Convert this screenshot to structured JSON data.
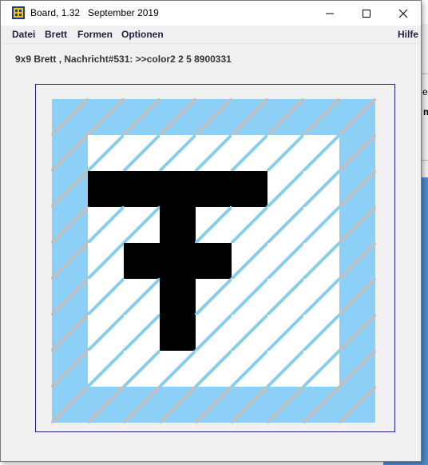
{
  "window": {
    "title": "Board, 1.32   September 2019",
    "controls": [
      "minimize",
      "maximize",
      "close"
    ]
  },
  "menu": {
    "left": [
      "Datei",
      "Brett",
      "Formen",
      "Optionen"
    ],
    "right": "Hilfe"
  },
  "status_text": "9x9 Brett , Nachricht#531: >>color2 2 5 8900331",
  "board": {
    "size": 9,
    "colors": {
      "border": "#8ccff7",
      "inner": "#ffffff",
      "filled": "#000000",
      "stripe_on_blue": "#c0c0c0",
      "stripe_on_white": "#87ceeb",
      "frame": "#20208a"
    },
    "filled_cells": [
      [
        2,
        1
      ],
      [
        2,
        2
      ],
      [
        2,
        3
      ],
      [
        2,
        4
      ],
      [
        2,
        5
      ],
      [
        3,
        3
      ],
      [
        4,
        2
      ],
      [
        4,
        3
      ],
      [
        4,
        4
      ],
      [
        5,
        3
      ],
      [
        6,
        3
      ]
    ]
  },
  "background_window": {
    "fragments": [
      "ep",
      "m"
    ]
  },
  "icons": {
    "app": "board-app-icon",
    "minimize": "minimize-icon",
    "maximize": "maximize-icon",
    "close": "close-icon"
  }
}
